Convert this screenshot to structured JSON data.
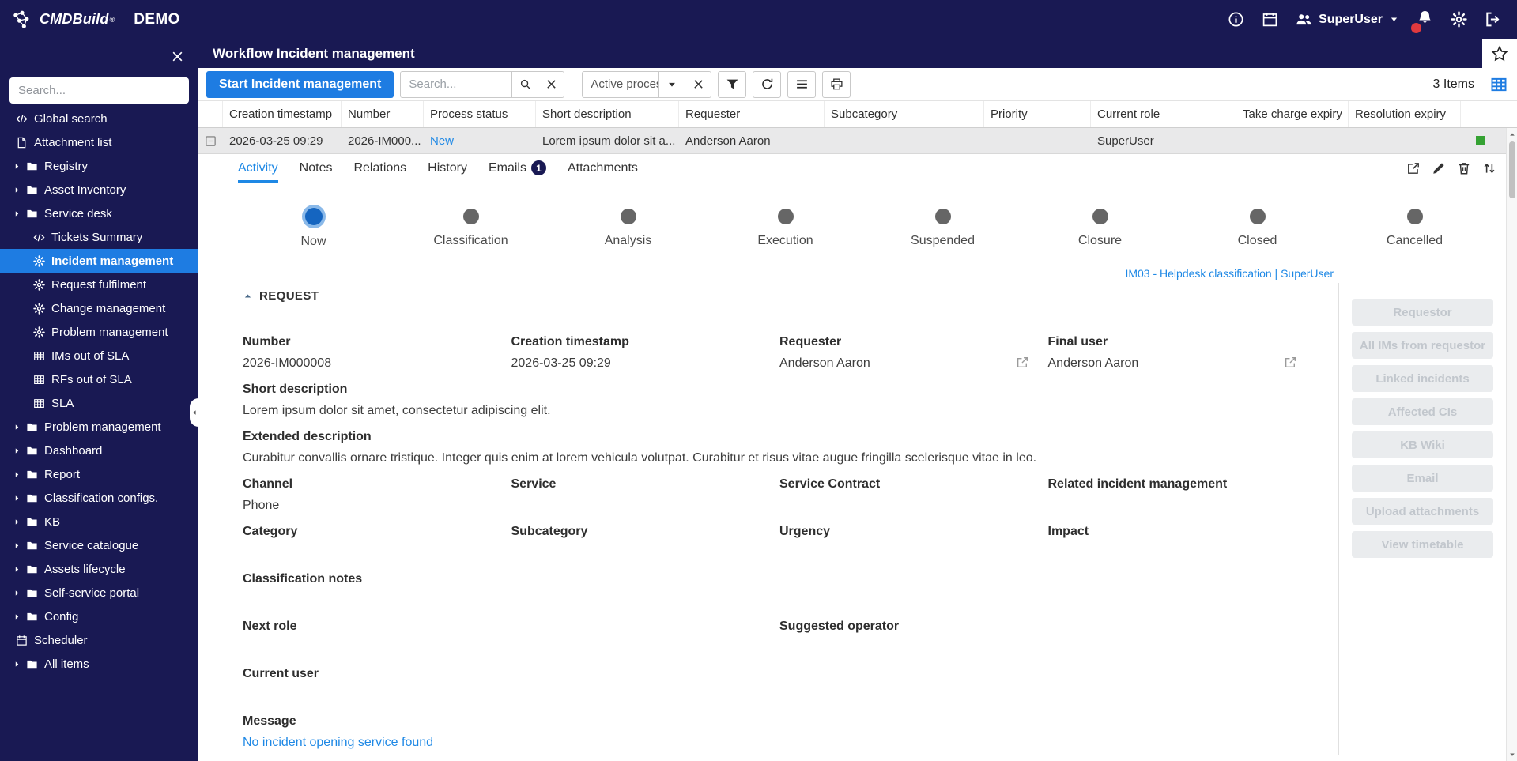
{
  "colors": {
    "navy": "#191953",
    "accent_blue": "#1e7ce2",
    "link_blue": "#1e88e5",
    "selected_row_bg": "#e9e9ea",
    "status_green": "#35a233",
    "notification_red": "#e0393e"
  },
  "topbar": {
    "brand": "CMDBuild",
    "brand_mark": "®",
    "env": "DEMO",
    "user": "SuperUser"
  },
  "page": {
    "title": "Workflow Incident management"
  },
  "sidebar": {
    "search_placeholder": "Search...",
    "items": [
      {
        "label": "Global search",
        "icon": "code-icon",
        "level": 0,
        "chevron": false
      },
      {
        "label": "Attachment list",
        "icon": "document-icon",
        "level": 0,
        "chevron": false
      },
      {
        "label": "Registry",
        "icon": "folder-icon",
        "level": 0,
        "chevron": true
      },
      {
        "label": "Asset Inventory",
        "icon": "folder-icon",
        "level": 0,
        "chevron": true
      },
      {
        "label": "Service desk",
        "icon": "folder-icon",
        "level": 0,
        "chevron": true
      },
      {
        "label": "Tickets Summary",
        "icon": "code-icon",
        "level": 1
      },
      {
        "label": "Incident management",
        "icon": "gear-icon",
        "level": 1,
        "active": true
      },
      {
        "label": "Request fulfilment",
        "icon": "gear-icon",
        "level": 1
      },
      {
        "label": "Change management",
        "icon": "gear-icon",
        "level": 1
      },
      {
        "label": "Problem management",
        "icon": "gear-icon",
        "level": 1
      },
      {
        "label": "IMs out of SLA",
        "icon": "table-icon",
        "level": 1
      },
      {
        "label": "RFs out of SLA",
        "icon": "table-icon",
        "level": 1
      },
      {
        "label": "SLA",
        "icon": "table-icon",
        "level": 1
      },
      {
        "label": "Problem management",
        "icon": "folder-icon",
        "level": 0,
        "chevron": true
      },
      {
        "label": "Dashboard",
        "icon": "folder-icon",
        "level": 0,
        "chevron": true
      },
      {
        "label": "Report",
        "icon": "folder-icon",
        "level": 0,
        "chevron": true
      },
      {
        "label": "Classification configs.",
        "icon": "folder-icon",
        "level": 0,
        "chevron": true
      },
      {
        "label": "KB",
        "icon": "folder-icon",
        "level": 0,
        "chevron": true
      },
      {
        "label": "Service catalogue",
        "icon": "folder-icon",
        "level": 0,
        "chevron": true
      },
      {
        "label": "Assets lifecycle",
        "icon": "folder-icon",
        "level": 0,
        "chevron": true
      },
      {
        "label": "Self-service portal",
        "icon": "folder-icon",
        "level": 0,
        "chevron": true
      },
      {
        "label": "Config",
        "icon": "folder-icon",
        "level": 0,
        "chevron": true
      },
      {
        "label": "Scheduler",
        "icon": "calendar-icon",
        "level": 0,
        "chevron": false
      },
      {
        "label": "All items",
        "icon": "folder-icon",
        "level": 0,
        "chevron": true
      }
    ]
  },
  "toolbar": {
    "start_button": "Start Incident management",
    "search_placeholder": "Search...",
    "process_filter": "Active processes",
    "items_count": "3 Items"
  },
  "table": {
    "columns": [
      "Creation timestamp",
      "Number",
      "Process status",
      "Short description",
      "Requester",
      "Subcategory",
      "Priority",
      "Current role",
      "Take charge expiry",
      "Resolution expiry"
    ],
    "row": {
      "cells": [
        {
          "text": "2026-03-25 09:29"
        },
        {
          "text": "2026-IM000..."
        },
        {
          "text": "New",
          "style": "status"
        },
        {
          "text": "Lorem ipsum dolor sit a..."
        },
        {
          "text": "Anderson Aaron"
        },
        {
          "text": ""
        },
        {
          "text": ""
        },
        {
          "text": "SuperUser"
        },
        {
          "text": ""
        },
        {
          "text": ""
        }
      ]
    }
  },
  "tabs": [
    {
      "label": "Activity",
      "active": true
    },
    {
      "label": "Notes"
    },
    {
      "label": "Relations"
    },
    {
      "label": "History"
    },
    {
      "label": "Emails",
      "badge": "1"
    },
    {
      "label": "Attachments"
    }
  ],
  "stepper": {
    "steps": [
      "Now",
      "Classification",
      "Analysis",
      "Execution",
      "Suspended",
      "Closure",
      "Closed",
      "Cancelled"
    ],
    "active_index": 0
  },
  "detail": {
    "context_link": "IM03 - Helpdesk classification | SuperUser",
    "section_title": "REQUEST",
    "rows": [
      {
        "cells": [
          {
            "label": "Number",
            "value": "2026-IM000008"
          },
          {
            "label": "Creation timestamp",
            "value": "2026-03-25 09:29"
          },
          {
            "label": "Requester",
            "value": "Anderson Aaron",
            "link_icon": true
          },
          {
            "label": "Final user",
            "value": "Anderson Aaron",
            "link_icon": true
          }
        ]
      },
      {
        "cells": [
          {
            "label": "Short description",
            "value": "Lorem ipsum dolor sit amet, consectetur adipiscing elit.",
            "span": 4
          }
        ]
      },
      {
        "cells": [
          {
            "label": "Extended description",
            "value": "Curabitur convallis ornare tristique. Integer quis enim at lorem vehicula volutpat. Curabitur et risus vitae augue fringilla scelerisque vitae in leo.",
            "span": 4
          }
        ]
      },
      {
        "cells": [
          {
            "label": "Channel",
            "value": "Phone"
          },
          {
            "label": "Service",
            "value": ""
          },
          {
            "label": "Service Contract",
            "value": ""
          },
          {
            "label": "Related incident management",
            "value": ""
          }
        ]
      },
      {
        "cells": [
          {
            "label": "Category",
            "value": ""
          },
          {
            "label": "Subcategory",
            "value": ""
          },
          {
            "label": "Urgency",
            "value": ""
          },
          {
            "label": "Impact",
            "value": ""
          }
        ]
      },
      {
        "cells": [
          {
            "label": "Classification notes",
            "value": "",
            "span": 4
          }
        ]
      },
      {
        "cells": [
          {
            "label": "Next role",
            "value": "",
            "span": 2
          },
          {
            "label": "Suggested operator",
            "value": "",
            "span": 2
          }
        ]
      },
      {
        "cells": [
          {
            "label": "Current user",
            "value": "",
            "span": 4
          }
        ]
      },
      {
        "cells": [
          {
            "label": "Message",
            "value": "No incident opening service found",
            "span": 4,
            "link": true
          }
        ]
      }
    ],
    "side_actions": [
      "Requestor",
      "All IMs from requestor",
      "Linked incidents",
      "Affected CIs",
      "KB Wiki",
      "Email",
      "Upload attachments",
      "View timetable"
    ]
  }
}
